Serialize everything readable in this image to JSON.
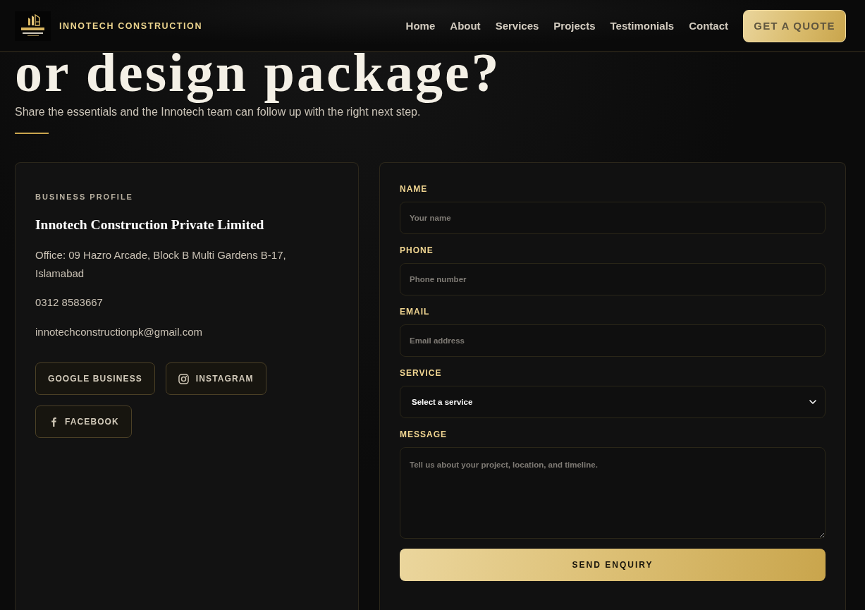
{
  "header": {
    "brand": "INNOTECH CONSTRUCTION",
    "nav": [
      {
        "label": "Home"
      },
      {
        "label": "About"
      },
      {
        "label": "Services"
      },
      {
        "label": "Projects"
      },
      {
        "label": "Testimonials"
      },
      {
        "label": "Contact"
      }
    ],
    "cta": "GET A QUOTE"
  },
  "hero": {
    "title": "or design package?",
    "subtitle": "Share the essentials and the Innotech team can follow up with the right next step."
  },
  "profile": {
    "eyebrow": "BUSINESS PROFILE",
    "company": "Innotech Construction Private Limited",
    "address": "Office: 09 Hazro Arcade, Block B Multi Gardens B-17, Islamabad",
    "phone": "0312 8583667",
    "email": "innotechconstructionpk@gmail.com",
    "links": [
      {
        "label": "GOOGLE BUSINESS",
        "kind": "plain"
      },
      {
        "label": "INSTAGRAM",
        "kind": "instagram"
      },
      {
        "label": "FACEBOOK",
        "kind": "facebook"
      }
    ]
  },
  "form": {
    "fields": [
      {
        "label": "NAME",
        "kind": "input",
        "placeholder": "Your name"
      },
      {
        "label": "PHONE",
        "kind": "input",
        "placeholder": "Phone number"
      },
      {
        "label": "EMAIL",
        "kind": "input",
        "placeholder": "Email address"
      },
      {
        "label": "SERVICE",
        "kind": "select",
        "value": "Select a service"
      },
      {
        "label": "MESSAGE",
        "kind": "textarea",
        "placeholder": "Tell us about your project, location, and timeline."
      }
    ],
    "submit": "SEND ENQUIRY"
  }
}
